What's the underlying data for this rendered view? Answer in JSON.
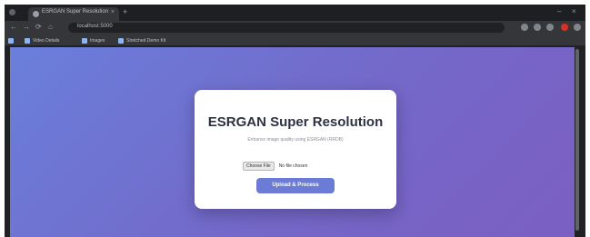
{
  "browser": {
    "tab_title": "ESRGAN Super Resolution",
    "tab_close": "×",
    "new_tab": "+",
    "window_controls": {
      "minimize": "–",
      "close": "×"
    },
    "nav": {
      "back": "←",
      "forward": "→",
      "reload": "⟳",
      "home": "⌂"
    },
    "address": "localhost:5000",
    "bookmarks": [
      "Video Details",
      "Images",
      "Stretched Demo Kit"
    ]
  },
  "page": {
    "title": "ESRGAN Super Resolution",
    "subtitle": "Enhance image quality using ESRGAN (RRDB)",
    "file_button": "Choose File",
    "file_status": "No file chosen",
    "submit_button": "Upload & Process"
  },
  "colors": {
    "gradient_start": "#6a7fdb",
    "gradient_end": "#7b5fc1",
    "button": "#6b7bd6"
  }
}
